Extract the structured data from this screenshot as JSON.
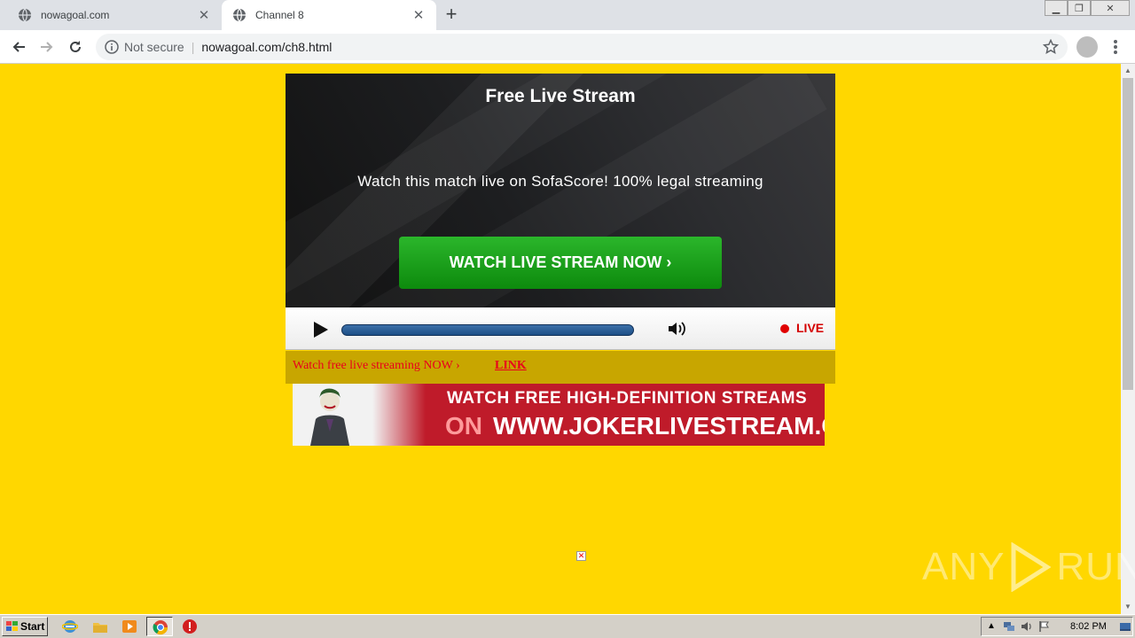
{
  "browser": {
    "tabs": [
      {
        "title": "nowagoal.com",
        "active": false
      },
      {
        "title": "Channel 8",
        "active": true
      }
    ],
    "address": {
      "security_label": "Not secure",
      "url": "nowagoal.com/ch8.html"
    }
  },
  "page": {
    "player": {
      "title": "Free Live Stream",
      "subtitle": "Watch this match live on SofaScore! 100% legal streaming",
      "cta_label": "WATCH LIVE STREAM NOW ›",
      "live_label": "LIVE"
    },
    "linkbar": {
      "text": "Watch free live streaming NOW ›",
      "link": "LINK"
    },
    "banner": {
      "line1": "WATCH FREE HIGH-DEFINITION STREAMS",
      "line2_prefix": "ON",
      "line2_site": "WWW.JOKERLIVESTREAM.COM"
    },
    "watermark": {
      "left": "ANY",
      "right": "RUN"
    }
  },
  "taskbar": {
    "start_label": "Start",
    "clock": "8:02 PM"
  },
  "colors": {
    "page_background": "#ffd700",
    "cta_green": "#1a9e1a",
    "live_red": "#d40000",
    "link_red": "#e8001c",
    "banner_red": "#bf1b2a"
  }
}
